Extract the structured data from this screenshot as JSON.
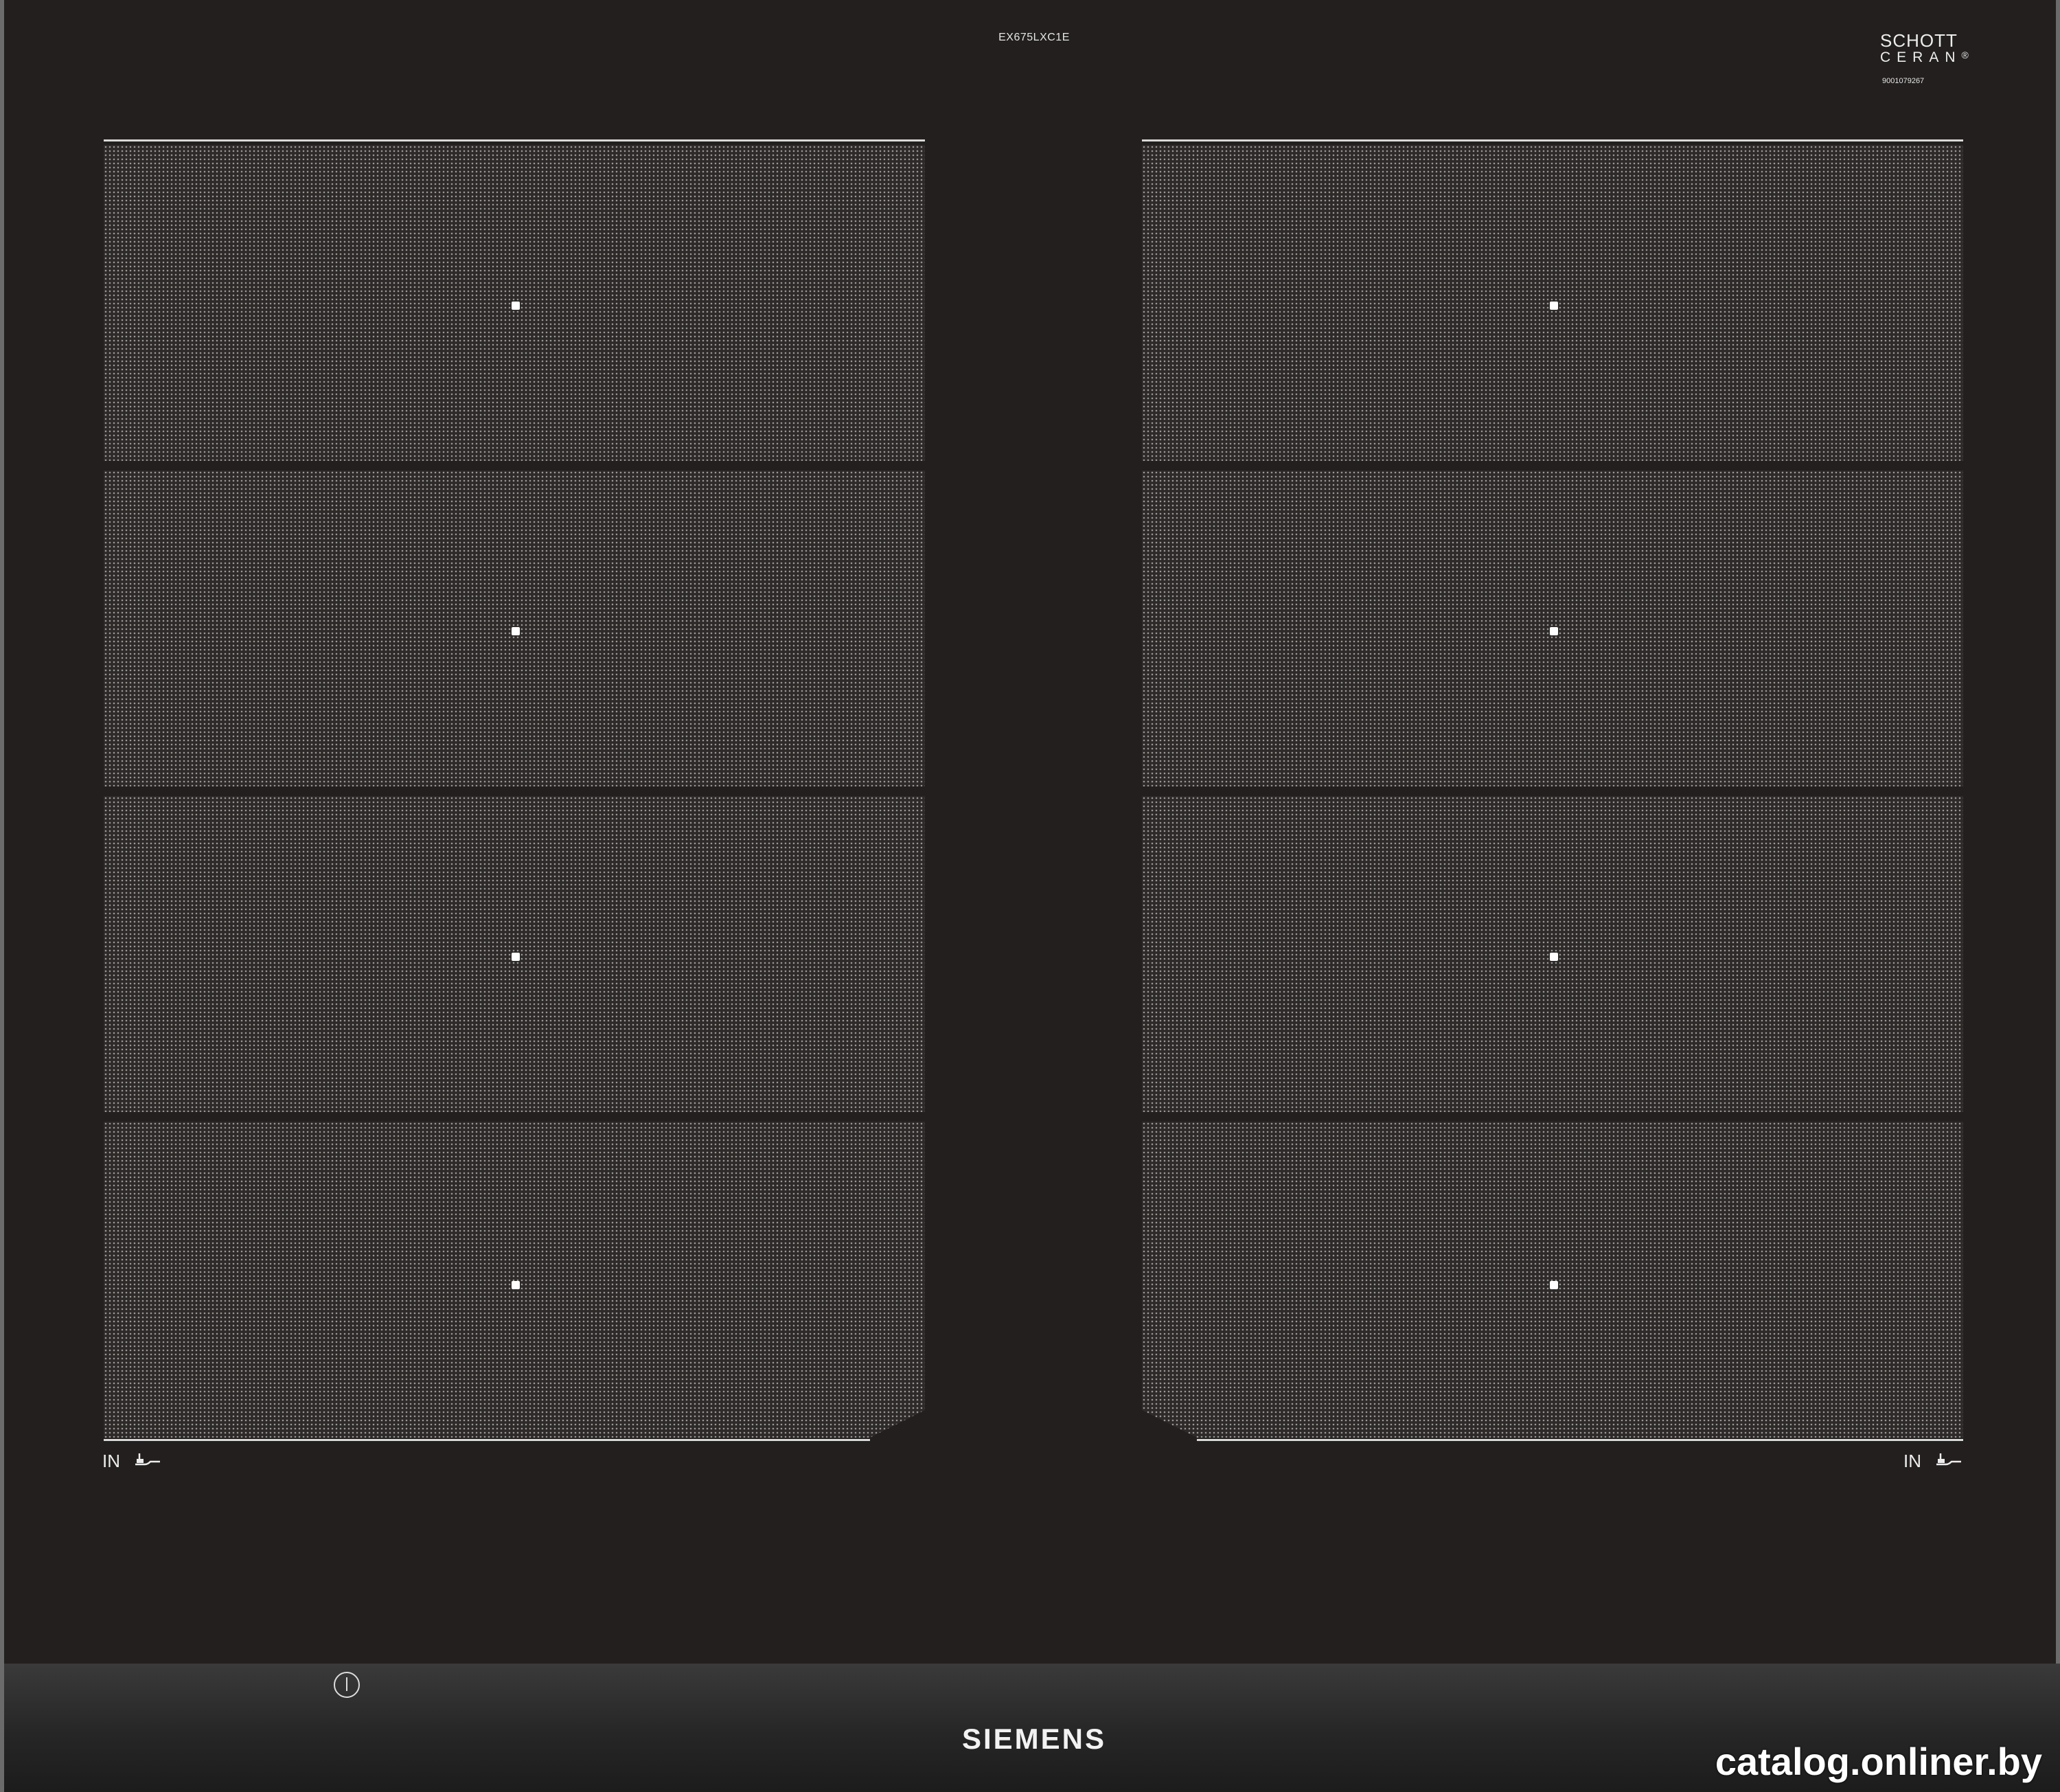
{
  "model_code": "EX675LXC1E",
  "glass_brand": {
    "line1": "SCHOTT",
    "line2": "CERAN",
    "reg": "®",
    "serial": "9001079267"
  },
  "zones": {
    "left": [
      "zone-1",
      "zone-2",
      "zone-3",
      "zone-4"
    ],
    "right": [
      "zone-1",
      "zone-2",
      "zone-3",
      "zone-4"
    ]
  },
  "indicators": {
    "left": "IN",
    "right": "IN"
  },
  "controls": {
    "brand": "SIEMENS",
    "power_icon": "power-icon"
  },
  "watermark": "catalog.onliner.by",
  "colors": {
    "glass": "#221f1e",
    "zone_dots": "#9a9895",
    "lines": "#d9d9d9"
  }
}
